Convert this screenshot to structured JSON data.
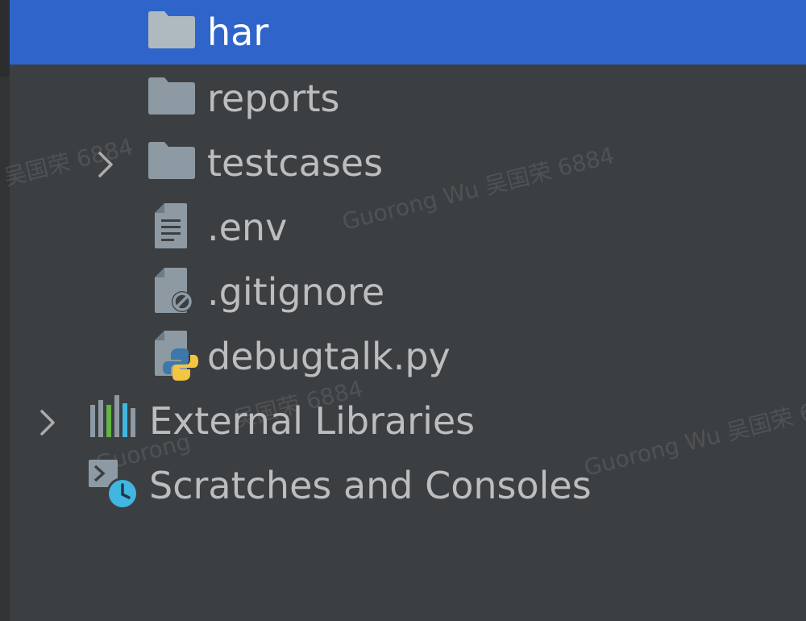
{
  "project_tree": {
    "items": [
      {
        "label": "har",
        "icon": "folder-icon",
        "selected": true
      },
      {
        "label": "reports",
        "icon": "folder-icon"
      },
      {
        "label": "testcases",
        "icon": "folder-icon",
        "expandable": true
      },
      {
        "label": ".env",
        "icon": "text-file-icon"
      },
      {
        "label": ".gitignore",
        "icon": "ignore-file-icon"
      },
      {
        "label": "debugtalk.py",
        "icon": "python-file-icon"
      },
      {
        "label": "External Libraries",
        "icon": "libraries-icon",
        "expandable": true
      },
      {
        "label": "Scratches and Consoles",
        "icon": "scratches-icon"
      }
    ]
  },
  "watermark": {
    "text_a": "Guorong Wu 吴国荣 6884",
    "text_b": "吴国荣 6884",
    "text_c": "Guorong Wu 吴国荣 6884",
    "text_d": "Guorong Wu 吴国荣 6884",
    "text_e": "Guorong"
  },
  "colors": {
    "background": "#3c3f41",
    "selection": "#2f65ca",
    "text": "#bbbdbf",
    "folder": "#aeb9c0",
    "python_blue": "#3c78aa",
    "python_yellow": "#f4c542",
    "lib_blue": "#40b6e0",
    "lib_green": "#62b543"
  }
}
